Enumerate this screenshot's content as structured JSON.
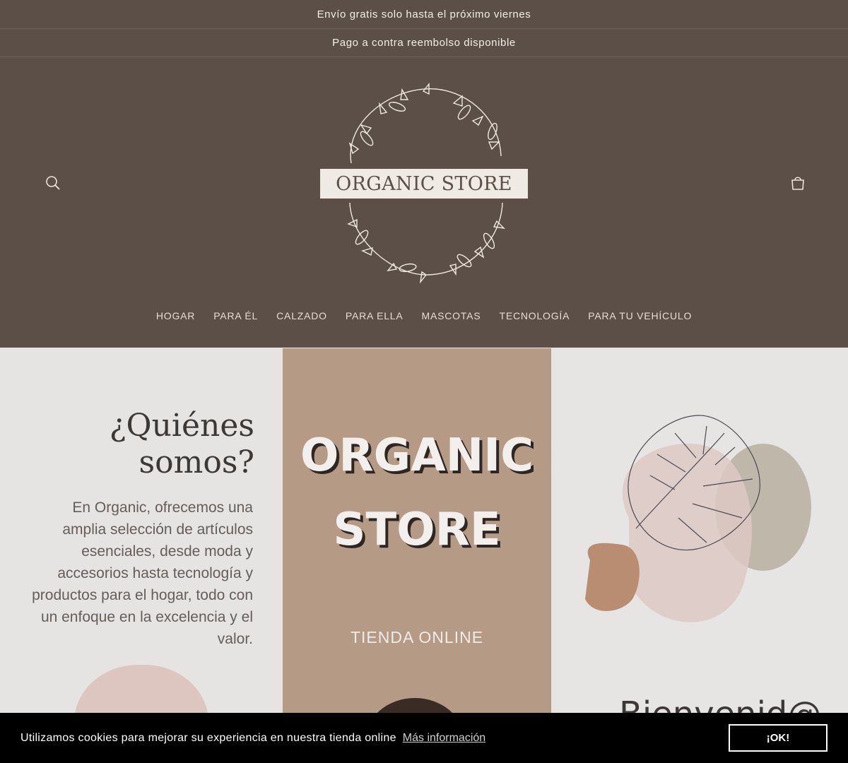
{
  "announcements": [
    "Envío gratis solo hasta el próximo viernes",
    "Pago a contra reembolso disponible"
  ],
  "header": {
    "logo_text": "ORGANIC STORE",
    "search_icon": "search-icon",
    "cart_icon": "cart-icon"
  },
  "nav": {
    "items": [
      {
        "label": "HOGAR"
      },
      {
        "label": "PARA ÉL"
      },
      {
        "label": "CALZADO"
      },
      {
        "label": "PARA ELLA"
      },
      {
        "label": "MASCOTAS"
      },
      {
        "label": "TECNOLOGÍA"
      },
      {
        "label": "PARA TU VEHÍCULO"
      }
    ]
  },
  "hero": {
    "who_title_line1": "¿Quiénes",
    "who_title_line2": "somos?",
    "who_text": "En Organic, ofrecemos una amplia selección de artículos esenciales, desde moda y accesorios hasta tecnología y productos para el hogar, todo con un enfoque en la excelencia y el valor.",
    "brand_line1": "ORGANIC",
    "brand_line2": "STORE",
    "tagline": "TIENDA ONLINE",
    "welcome": "Bienvenid@"
  },
  "cookie": {
    "text": "Utilizamos cookies para mejorar su experiencia en nuestra tienda online",
    "link": "Más información",
    "button": "¡OK!"
  },
  "colors": {
    "header_bg": "#5b4f47",
    "logo_box": "#efeae3",
    "hero_mid": "#b59a86",
    "cookie_bg": "#000000"
  }
}
